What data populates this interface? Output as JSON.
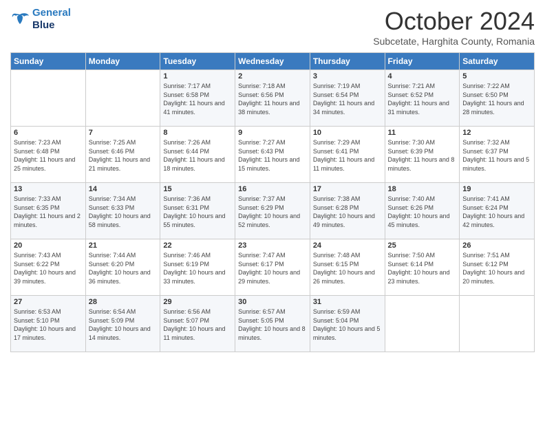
{
  "logo": {
    "line1": "General",
    "line2": "Blue"
  },
  "title": "October 2024",
  "subtitle": "Subcetate, Harghita County, Romania",
  "days_of_week": [
    "Sunday",
    "Monday",
    "Tuesday",
    "Wednesday",
    "Thursday",
    "Friday",
    "Saturday"
  ],
  "weeks": [
    [
      {
        "day": "",
        "sunrise": "",
        "sunset": "",
        "daylight": ""
      },
      {
        "day": "",
        "sunrise": "",
        "sunset": "",
        "daylight": ""
      },
      {
        "day": "1",
        "sunrise": "Sunrise: 7:17 AM",
        "sunset": "Sunset: 6:58 PM",
        "daylight": "Daylight: 11 hours and 41 minutes."
      },
      {
        "day": "2",
        "sunrise": "Sunrise: 7:18 AM",
        "sunset": "Sunset: 6:56 PM",
        "daylight": "Daylight: 11 hours and 38 minutes."
      },
      {
        "day": "3",
        "sunrise": "Sunrise: 7:19 AM",
        "sunset": "Sunset: 6:54 PM",
        "daylight": "Daylight: 11 hours and 34 minutes."
      },
      {
        "day": "4",
        "sunrise": "Sunrise: 7:21 AM",
        "sunset": "Sunset: 6:52 PM",
        "daylight": "Daylight: 11 hours and 31 minutes."
      },
      {
        "day": "5",
        "sunrise": "Sunrise: 7:22 AM",
        "sunset": "Sunset: 6:50 PM",
        "daylight": "Daylight: 11 hours and 28 minutes."
      }
    ],
    [
      {
        "day": "6",
        "sunrise": "Sunrise: 7:23 AM",
        "sunset": "Sunset: 6:48 PM",
        "daylight": "Daylight: 11 hours and 25 minutes."
      },
      {
        "day": "7",
        "sunrise": "Sunrise: 7:25 AM",
        "sunset": "Sunset: 6:46 PM",
        "daylight": "Daylight: 11 hours and 21 minutes."
      },
      {
        "day": "8",
        "sunrise": "Sunrise: 7:26 AM",
        "sunset": "Sunset: 6:44 PM",
        "daylight": "Daylight: 11 hours and 18 minutes."
      },
      {
        "day": "9",
        "sunrise": "Sunrise: 7:27 AM",
        "sunset": "Sunset: 6:43 PM",
        "daylight": "Daylight: 11 hours and 15 minutes."
      },
      {
        "day": "10",
        "sunrise": "Sunrise: 7:29 AM",
        "sunset": "Sunset: 6:41 PM",
        "daylight": "Daylight: 11 hours and 11 minutes."
      },
      {
        "day": "11",
        "sunrise": "Sunrise: 7:30 AM",
        "sunset": "Sunset: 6:39 PM",
        "daylight": "Daylight: 11 hours and 8 minutes."
      },
      {
        "day": "12",
        "sunrise": "Sunrise: 7:32 AM",
        "sunset": "Sunset: 6:37 PM",
        "daylight": "Daylight: 11 hours and 5 minutes."
      }
    ],
    [
      {
        "day": "13",
        "sunrise": "Sunrise: 7:33 AM",
        "sunset": "Sunset: 6:35 PM",
        "daylight": "Daylight: 11 hours and 2 minutes."
      },
      {
        "day": "14",
        "sunrise": "Sunrise: 7:34 AM",
        "sunset": "Sunset: 6:33 PM",
        "daylight": "Daylight: 10 hours and 58 minutes."
      },
      {
        "day": "15",
        "sunrise": "Sunrise: 7:36 AM",
        "sunset": "Sunset: 6:31 PM",
        "daylight": "Daylight: 10 hours and 55 minutes."
      },
      {
        "day": "16",
        "sunrise": "Sunrise: 7:37 AM",
        "sunset": "Sunset: 6:29 PM",
        "daylight": "Daylight: 10 hours and 52 minutes."
      },
      {
        "day": "17",
        "sunrise": "Sunrise: 7:38 AM",
        "sunset": "Sunset: 6:28 PM",
        "daylight": "Daylight: 10 hours and 49 minutes."
      },
      {
        "day": "18",
        "sunrise": "Sunrise: 7:40 AM",
        "sunset": "Sunset: 6:26 PM",
        "daylight": "Daylight: 10 hours and 45 minutes."
      },
      {
        "day": "19",
        "sunrise": "Sunrise: 7:41 AM",
        "sunset": "Sunset: 6:24 PM",
        "daylight": "Daylight: 10 hours and 42 minutes."
      }
    ],
    [
      {
        "day": "20",
        "sunrise": "Sunrise: 7:43 AM",
        "sunset": "Sunset: 6:22 PM",
        "daylight": "Daylight: 10 hours and 39 minutes."
      },
      {
        "day": "21",
        "sunrise": "Sunrise: 7:44 AM",
        "sunset": "Sunset: 6:20 PM",
        "daylight": "Daylight: 10 hours and 36 minutes."
      },
      {
        "day": "22",
        "sunrise": "Sunrise: 7:46 AM",
        "sunset": "Sunset: 6:19 PM",
        "daylight": "Daylight: 10 hours and 33 minutes."
      },
      {
        "day": "23",
        "sunrise": "Sunrise: 7:47 AM",
        "sunset": "Sunset: 6:17 PM",
        "daylight": "Daylight: 10 hours and 29 minutes."
      },
      {
        "day": "24",
        "sunrise": "Sunrise: 7:48 AM",
        "sunset": "Sunset: 6:15 PM",
        "daylight": "Daylight: 10 hours and 26 minutes."
      },
      {
        "day": "25",
        "sunrise": "Sunrise: 7:50 AM",
        "sunset": "Sunset: 6:14 PM",
        "daylight": "Daylight: 10 hours and 23 minutes."
      },
      {
        "day": "26",
        "sunrise": "Sunrise: 7:51 AM",
        "sunset": "Sunset: 6:12 PM",
        "daylight": "Daylight: 10 hours and 20 minutes."
      }
    ],
    [
      {
        "day": "27",
        "sunrise": "Sunrise: 6:53 AM",
        "sunset": "Sunset: 5:10 PM",
        "daylight": "Daylight: 10 hours and 17 minutes."
      },
      {
        "day": "28",
        "sunrise": "Sunrise: 6:54 AM",
        "sunset": "Sunset: 5:09 PM",
        "daylight": "Daylight: 10 hours and 14 minutes."
      },
      {
        "day": "29",
        "sunrise": "Sunrise: 6:56 AM",
        "sunset": "Sunset: 5:07 PM",
        "daylight": "Daylight: 10 hours and 11 minutes."
      },
      {
        "day": "30",
        "sunrise": "Sunrise: 6:57 AM",
        "sunset": "Sunset: 5:05 PM",
        "daylight": "Daylight: 10 hours and 8 minutes."
      },
      {
        "day": "31",
        "sunrise": "Sunrise: 6:59 AM",
        "sunset": "Sunset: 5:04 PM",
        "daylight": "Daylight: 10 hours and 5 minutes."
      },
      {
        "day": "",
        "sunrise": "",
        "sunset": "",
        "daylight": ""
      },
      {
        "day": "",
        "sunrise": "",
        "sunset": "",
        "daylight": ""
      }
    ]
  ]
}
